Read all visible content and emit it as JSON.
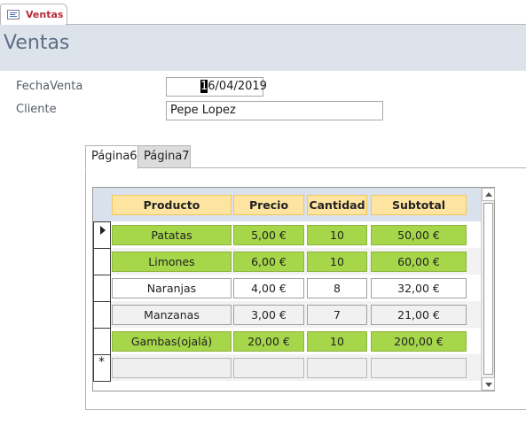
{
  "document_tab": {
    "label": "Ventas",
    "icon": "form-icon"
  },
  "form": {
    "title": "Ventas"
  },
  "fields": {
    "fecha_venta": {
      "label": "FechaVenta",
      "value_caret_char": "1",
      "value_rest": "6/04/2019"
    },
    "cliente": {
      "label": "Cliente",
      "value": "Pepe Lopez"
    }
  },
  "subform_tabs": [
    {
      "label": "Página6",
      "active": true
    },
    {
      "label": "Página7",
      "active": false
    }
  ],
  "grid": {
    "headers": [
      "Producto",
      "Precio",
      "Cantidad",
      "Subtotal"
    ],
    "rows": [
      {
        "producto": "Patatas",
        "precio": "5,00 €",
        "cantidad": "10",
        "subtotal": "50,00 €",
        "style": "green",
        "current": true
      },
      {
        "producto": "Limones",
        "precio": "6,00 €",
        "cantidad": "10",
        "subtotal": "60,00 €",
        "style": "green",
        "current": false
      },
      {
        "producto": "Naranjas",
        "precio": "4,00 €",
        "cantidad": "8",
        "subtotal": "32,00 €",
        "style": "white",
        "current": false
      },
      {
        "producto": "Manzanas",
        "precio": "3,00 €",
        "cantidad": "7",
        "subtotal": "21,00 €",
        "style": "grey",
        "current": false
      },
      {
        "producto": "Gambas(ojalá)",
        "precio": "20,00 €",
        "cantidad": "10",
        "subtotal": "200,00 €",
        "style": "green",
        "current": false
      }
    ],
    "new_record_marker": "*"
  },
  "colors": {
    "header_band": "#dde3ea",
    "title_text": "#5b6e86",
    "column_header_fill": "#fde4a0",
    "highlight_green": "#a6d64a",
    "tab_label_red": "#b52b3a"
  }
}
